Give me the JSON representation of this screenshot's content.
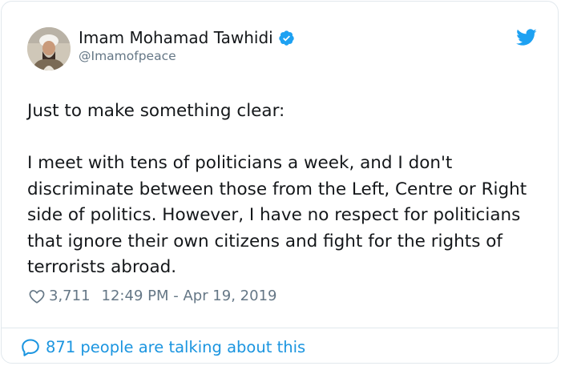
{
  "author": {
    "name": "Imam Mohamad Tawhidi",
    "handle": "@Imamofpeace",
    "verified": true
  },
  "tweet": {
    "text": "Just to make something clear:\n\nI meet with tens of politicians a week, and I don't discriminate between those from the Left, Centre or Right side of politics. However, I have no respect for politicians that ignore their own citizens and fight for the rights of terrorists abroad."
  },
  "meta": {
    "likes": "3,711",
    "timestamp": "12:49 PM - Apr 19, 2019"
  },
  "footer": {
    "talking_label": "871 people are talking about this"
  },
  "icons": {
    "verified": "verified-badge-icon",
    "brand": "twitter-bird-icon",
    "like": "heart-icon",
    "talk": "speech-bubble-icon"
  },
  "colors": {
    "brand_blue": "#1da1f2",
    "link_blue": "#1b95e0",
    "text": "#14171a",
    "muted": "#657786",
    "border": "#e1e8ed"
  }
}
